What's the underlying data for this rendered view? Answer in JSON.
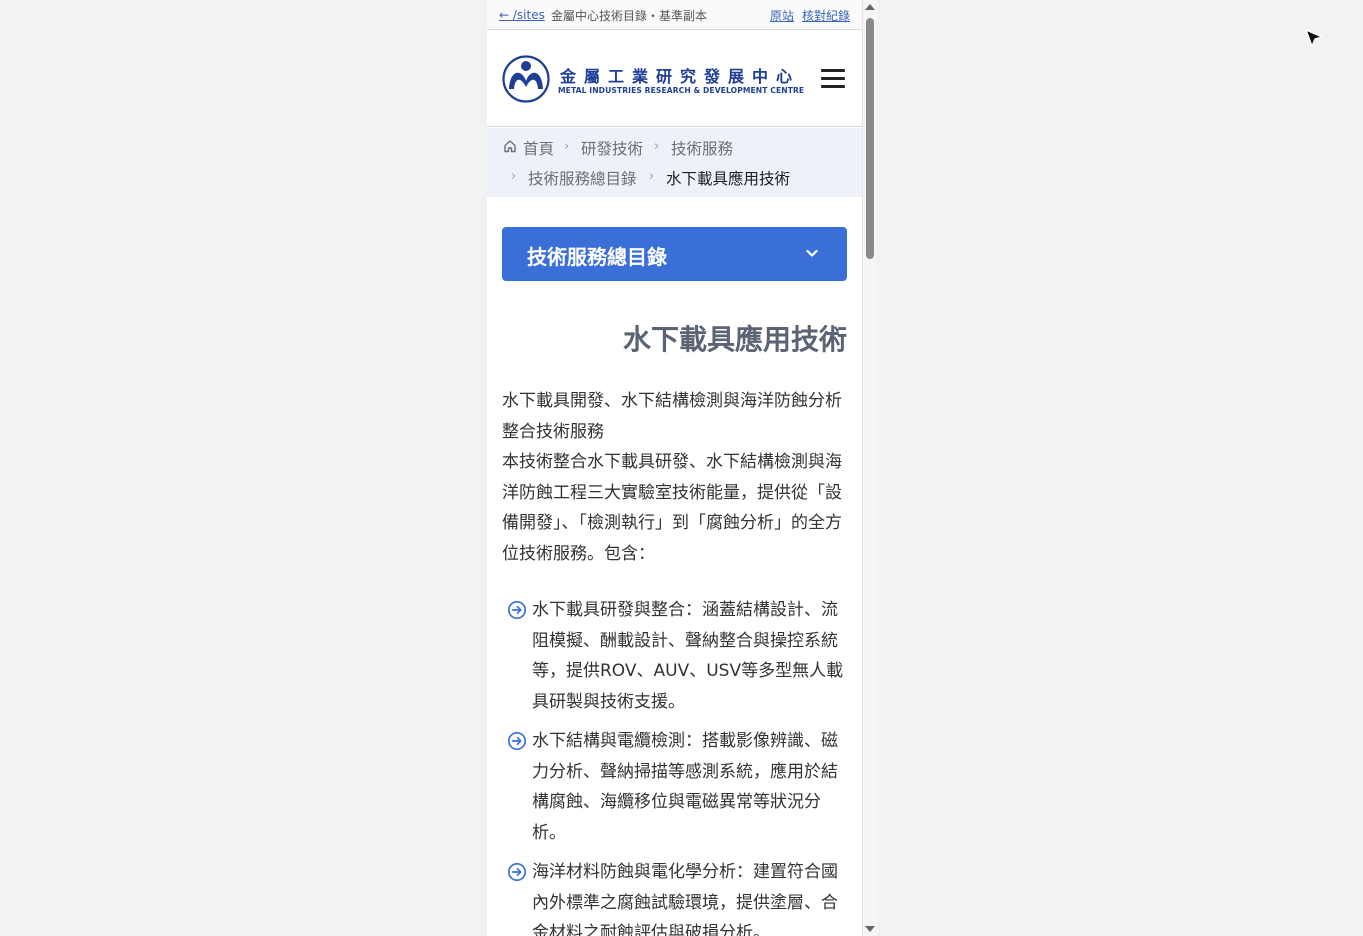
{
  "topbar": {
    "back_label": "← /sites",
    "title": "金屬中心技術目錄・基準副本",
    "link_original": "原站",
    "link_log": "核對紀錄"
  },
  "header": {
    "logo_zh": "金屬工業研究發展中心",
    "logo_en": "METAL INDUSTRIES RESEARCH & DEVELOPMENT CENTRE",
    "logo_badge": "MIRDC"
  },
  "breadcrumb": {
    "items": [
      "首頁",
      "研發技術",
      "技術服務",
      "技術服務總目錄",
      "水下載具應用技術"
    ]
  },
  "dropdown": {
    "label": "技術服務總目錄"
  },
  "page": {
    "title": "水下載具應用技術",
    "intro_1": "水下載具開發、水下結構檢測與海洋防蝕分析整合技術服務",
    "intro_2": "本技術整合水下載具研發、水下結構檢測與海洋防蝕工程三大實驗室技術能量，提供從「設備開發」、「檢測執行」到「腐蝕分析」的全方位技術服務。包含：",
    "list": [
      "水下載具研發與整合：涵蓋結構設計、流阻模擬、酬載設計、聲納整合與操控系統等，提供ROV、AUV、USV等多型無人載具研製與技術支援。",
      "水下結構與電纜檢測：搭載影像辨識、磁力分析、聲納掃描等感測系統，應用於結構腐蝕、海纜移位與電磁異常等狀況分析。",
      "海洋材料防蝕與電化學分析：建置符合國內外標準之腐蝕試驗環境，提供塗層、合金材料之耐蝕評估與破損分析。"
    ]
  },
  "colors": {
    "accent": "#3b6fd8",
    "logo_blue": "#1f3f94",
    "breadcrumb_bg": "#eef1f8"
  },
  "icons": [
    "home-icon",
    "chevron-right-icon",
    "chevron-down-icon",
    "hamburger-menu-icon",
    "circle-arrow-right-icon",
    "mouse-cursor-icon"
  ]
}
